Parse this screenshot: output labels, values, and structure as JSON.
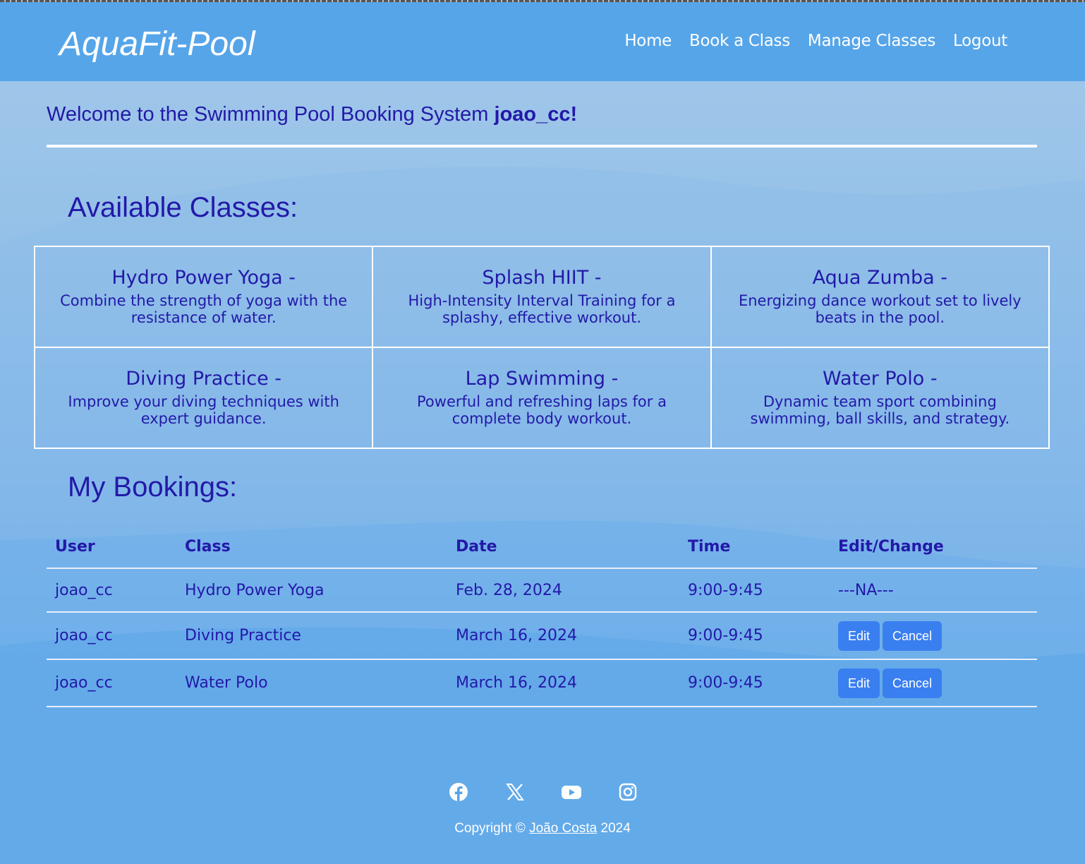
{
  "header": {
    "brand": "AquaFit-Pool",
    "nav": [
      "Home",
      "Book a Class",
      "Manage Classes",
      "Logout"
    ]
  },
  "welcome": {
    "text": "Welcome to the Swimming Pool Booking System",
    "username": "joao_cc!"
  },
  "available": {
    "title": "Available Classes:",
    "classes": [
      {
        "name": "Hydro Power Yoga -",
        "desc": "Combine the strength of yoga with the resistance of water."
      },
      {
        "name": "Splash HIIT -",
        "desc": "High-Intensity Interval Training for a splashy, effective workout."
      },
      {
        "name": "Aqua Zumba -",
        "desc": "Energizing dance workout set to lively beats in the pool."
      },
      {
        "name": "Diving Practice -",
        "desc": "Improve your diving techniques with expert guidance."
      },
      {
        "name": "Lap Swimming -",
        "desc": "Powerful and refreshing laps for a complete body workout."
      },
      {
        "name": "Water Polo -",
        "desc": "Dynamic team sport combining swimming, ball skills, and strategy."
      }
    ]
  },
  "bookings": {
    "title": "My Bookings:",
    "columns": [
      "User",
      "Class",
      "Date",
      "Time",
      "Edit/Change"
    ],
    "rows": [
      {
        "user": "joao_cc",
        "class": "Hydro Power Yoga",
        "date": "Feb. 28, 2024",
        "time": "9:00-9:45",
        "na": "---NA---"
      },
      {
        "user": "joao_cc",
        "class": "Diving Practice",
        "date": "March 16, 2024",
        "time": "9:00-9:45"
      },
      {
        "user": "joao_cc",
        "class": "Water Polo",
        "date": "March 16, 2024",
        "time": "9:00-9:45"
      }
    ],
    "edit_label": "Edit",
    "cancel_label": "Cancel"
  },
  "footer": {
    "social": [
      "facebook-icon",
      "x-icon",
      "youtube-icon",
      "instagram-icon"
    ],
    "copyright_prefix": "Copyright ©",
    "author": "João Costa",
    "year": "2024"
  }
}
